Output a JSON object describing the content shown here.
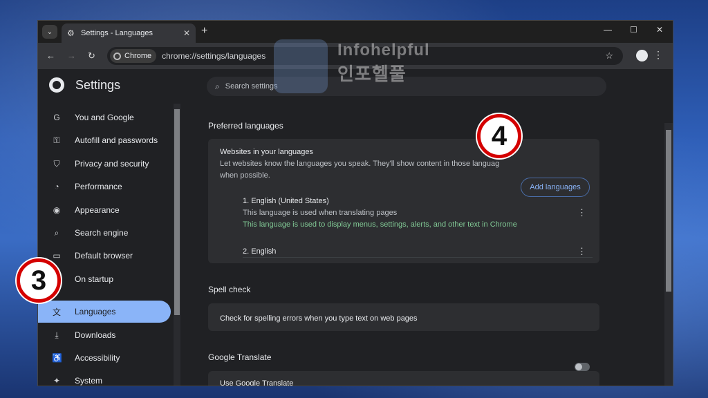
{
  "browser": {
    "tab_title": "Settings - Languages",
    "chip_label": "Chrome",
    "url": "chrome://settings/languages"
  },
  "settings": {
    "title": "Settings",
    "search_placeholder": "Search settings",
    "sidebar": [
      {
        "label": "You and Google",
        "icon": "google-icon"
      },
      {
        "label": "Autofill and passwords",
        "icon": "key-icon"
      },
      {
        "label": "Privacy and security",
        "icon": "shield-icon"
      },
      {
        "label": "Performance",
        "icon": "gauge-icon"
      },
      {
        "label": "Appearance",
        "icon": "palette-icon"
      },
      {
        "label": "Search engine",
        "icon": "search-icon"
      },
      {
        "label": "Default browser",
        "icon": "browser-icon"
      },
      {
        "label": "On startup",
        "icon": "power-icon"
      },
      {
        "label": "Languages",
        "icon": "translate-icon"
      },
      {
        "label": "Downloads",
        "icon": "download-icon"
      },
      {
        "label": "Accessibility",
        "icon": "accessibility-icon"
      },
      {
        "label": "System",
        "icon": "wrench-icon"
      }
    ]
  },
  "preferred": {
    "section_title": "Preferred languages",
    "card_title": "Websites in your languages",
    "card_desc_1": "Let websites know the languages you speak. They'll show content in those languag",
    "card_desc_2": "when possible.",
    "add_label": "Add languages",
    "languages": [
      {
        "name": "1. English (United States)",
        "detail": "This language is used when translating pages",
        "note": "This language is used to display menus, settings, alerts, and other text in Chrome"
      },
      {
        "name": "2. English"
      }
    ]
  },
  "spell": {
    "section_title": "Spell check",
    "row_label": "Check for spelling errors when you type text on web pages"
  },
  "translate": {
    "section_title": "Google Translate",
    "row_label": "Use Google Translate"
  },
  "annotations": {
    "step3": "3",
    "step4": "4",
    "watermark_en": "Infohelpful",
    "watermark_ko": "인포헬풀"
  }
}
